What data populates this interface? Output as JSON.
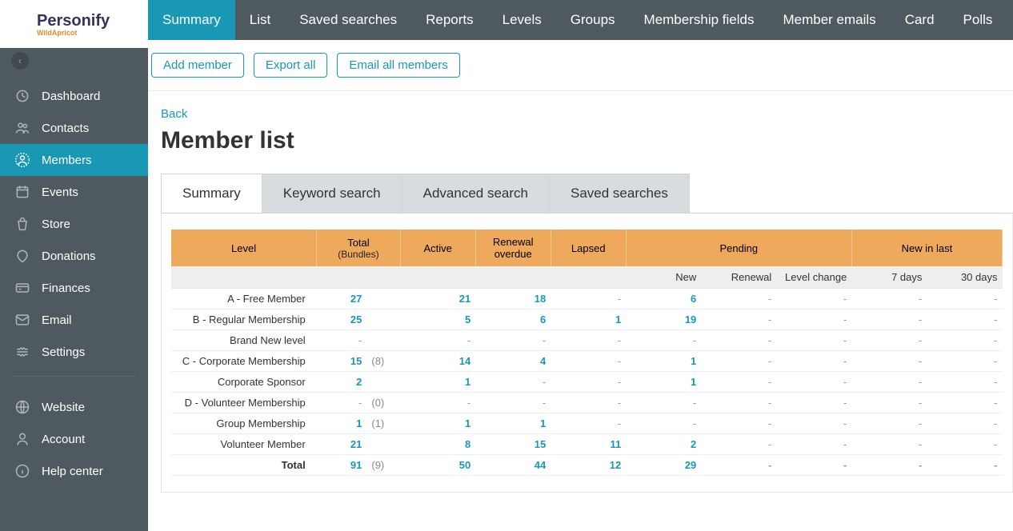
{
  "brand": {
    "name": "Personify",
    "subname": "WildApricot"
  },
  "sidebar": {
    "items": [
      {
        "label": "Dashboard"
      },
      {
        "label": "Contacts"
      },
      {
        "label": "Members",
        "active": true
      },
      {
        "label": "Events"
      },
      {
        "label": "Store"
      },
      {
        "label": "Donations"
      },
      {
        "label": "Finances"
      },
      {
        "label": "Email"
      },
      {
        "label": "Settings"
      }
    ],
    "items2": [
      {
        "label": "Website"
      },
      {
        "label": "Account"
      },
      {
        "label": "Help center"
      }
    ]
  },
  "topnav": {
    "items": [
      {
        "label": "Summary",
        "active": true
      },
      {
        "label": "List"
      },
      {
        "label": "Saved searches"
      },
      {
        "label": "Reports"
      },
      {
        "label": "Levels"
      },
      {
        "label": "Groups"
      },
      {
        "label": "Membership fields"
      },
      {
        "label": "Member emails"
      },
      {
        "label": "Card"
      },
      {
        "label": "Polls"
      }
    ]
  },
  "actions": {
    "add": "Add member",
    "export": "Export all",
    "email": "Email all members"
  },
  "back_label": "Back",
  "page_title": "Member list",
  "tabs": {
    "items": [
      {
        "label": "Summary",
        "active": true
      },
      {
        "label": "Keyword search"
      },
      {
        "label": "Advanced search"
      },
      {
        "label": "Saved searches"
      }
    ]
  },
  "table": {
    "headers": {
      "level": "Level",
      "total": "Total",
      "bundles": "(Bundles)",
      "active": "Active",
      "renewal_overdue": "Renewal overdue",
      "lapsed": "Lapsed",
      "pending": "Pending",
      "new_in_last": "New in last",
      "new": "New",
      "renewal": "Renewal",
      "level_change": "Level change",
      "d7": "7 days",
      "d30": "30 days"
    },
    "rows": [
      {
        "level": "A - Free Member",
        "total": "27",
        "bundles": "",
        "active": "21",
        "renewal_overdue": "18",
        "lapsed": "-",
        "new": "6",
        "renewal": "-",
        "level_change": "-",
        "d7": "-",
        "d30": "-"
      },
      {
        "level": "B - Regular Membership",
        "total": "25",
        "bundles": "",
        "active": "5",
        "renewal_overdue": "6",
        "lapsed": "1",
        "new": "19",
        "renewal": "-",
        "level_change": "-",
        "d7": "-",
        "d30": "-"
      },
      {
        "level": "Brand New level",
        "total": "-",
        "bundles": "",
        "active": "-",
        "renewal_overdue": "-",
        "lapsed": "-",
        "new": "-",
        "renewal": "-",
        "level_change": "-",
        "d7": "-",
        "d30": "-"
      },
      {
        "level": "C - Corporate Membership",
        "total": "15",
        "bundles": "(8)",
        "active": "14",
        "renewal_overdue": "4",
        "lapsed": "-",
        "new": "1",
        "renewal": "-",
        "level_change": "-",
        "d7": "-",
        "d30": "-"
      },
      {
        "level": "Corporate Sponsor",
        "total": "2",
        "bundles": "",
        "active": "1",
        "renewal_overdue": "-",
        "lapsed": "-",
        "new": "1",
        "renewal": "-",
        "level_change": "-",
        "d7": "-",
        "d30": "-"
      },
      {
        "level": "D - Volunteer Membership",
        "total": "-",
        "bundles": "(0)",
        "active": "-",
        "renewal_overdue": "-",
        "lapsed": "-",
        "new": "-",
        "renewal": "-",
        "level_change": "-",
        "d7": "-",
        "d30": "-"
      },
      {
        "level": "Group Membership",
        "total": "1",
        "bundles": "(1)",
        "active": "1",
        "renewal_overdue": "1",
        "lapsed": "-",
        "new": "-",
        "renewal": "-",
        "level_change": "-",
        "d7": "-",
        "d30": "-"
      },
      {
        "level": "Volunteer Member",
        "total": "21",
        "bundles": "",
        "active": "8",
        "renewal_overdue": "15",
        "lapsed": "11",
        "new": "2",
        "renewal": "-",
        "level_change": "-",
        "d7": "-",
        "d30": "-"
      }
    ],
    "total_row": {
      "level": "Total",
      "total": "91",
      "bundles": "(9)",
      "active": "50",
      "renewal_overdue": "44",
      "lapsed": "12",
      "new": "29",
      "renewal": "-",
      "level_change": "-",
      "d7": "-",
      "d30": "-"
    }
  }
}
